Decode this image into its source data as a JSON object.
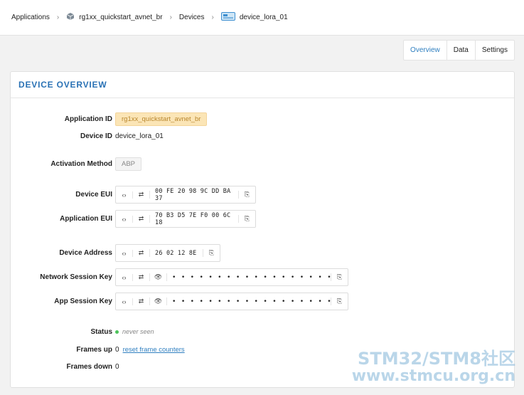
{
  "breadcrumb": {
    "applications": "Applications",
    "app_name": "rg1xx_quickstart_avnet_br",
    "devices": "Devices",
    "device_name": "device_lora_01"
  },
  "tabs": [
    {
      "label": "Overview",
      "active": true
    },
    {
      "label": "Data",
      "active": false
    },
    {
      "label": "Settings",
      "active": false
    }
  ],
  "card": {
    "title": "DEVICE OVERVIEW"
  },
  "fields": {
    "application_id": {
      "label": "Application ID",
      "value": "rg1xx_quickstart_avnet_br"
    },
    "device_id": {
      "label": "Device ID",
      "value": "device_lora_01"
    },
    "activation_method": {
      "label": "Activation Method",
      "value": "ABP"
    },
    "device_eui": {
      "label": "Device EUI",
      "value": "00 FE 20 98 9C DD BA 37"
    },
    "application_eui": {
      "label": "Application EUI",
      "value": "70 B3 D5 7E F0 00 6C 18"
    },
    "device_address": {
      "label": "Device Address",
      "value": "26 02 12 8E"
    },
    "network_session_key": {
      "label": "Network Session Key",
      "value": "• • • • • • • • • • • • • • • • • • • • • • • • • • • • • • • •"
    },
    "app_session_key": {
      "label": "App Session Key",
      "value": "• • • • • • • • • • • • • • • • • • • • • • • • • • • • • • • •"
    },
    "status": {
      "label": "Status",
      "value": "never seen"
    },
    "frames_up": {
      "label": "Frames up",
      "value": "0",
      "link": "reset frame counters"
    },
    "frames_down": {
      "label": "Frames down",
      "value": "0"
    }
  },
  "buttons": {
    "toggle_format": "‹›",
    "byte_order": "⇄",
    "show": "👁",
    "copy": "⎘"
  },
  "colors": {
    "accent": "#2f7fc0",
    "title": "#2a72b5",
    "status_dot": "#4cc35a",
    "app_tag_bg": "#fbe5b6"
  },
  "watermark": {
    "line1": "STM32/STM8社区",
    "line2": "www.stmcu.org.cn"
  }
}
